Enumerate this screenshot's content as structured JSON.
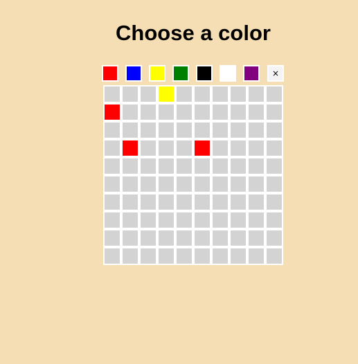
{
  "title": "Choose a color",
  "palette": [
    {
      "name": "red",
      "color": "#ff0000"
    },
    {
      "name": "blue",
      "color": "#0000ff"
    },
    {
      "name": "yellow",
      "color": "#ffff00"
    },
    {
      "name": "green",
      "color": "#008000"
    },
    {
      "name": "black",
      "color": "#000000"
    },
    {
      "name": "white",
      "color": "#ffffff"
    },
    {
      "name": "purple",
      "color": "#800080"
    }
  ],
  "clear_button": {
    "label": "×"
  },
  "grid": {
    "rows": 10,
    "cols": 10,
    "empty_color": "#d3d3d3",
    "painted": [
      {
        "row": 0,
        "col": 3,
        "color": "#ffff00"
      },
      {
        "row": 1,
        "col": 0,
        "color": "#ff0000"
      },
      {
        "row": 3,
        "col": 1,
        "color": "#ff0000"
      },
      {
        "row": 3,
        "col": 5,
        "color": "#ff0000"
      }
    ]
  }
}
